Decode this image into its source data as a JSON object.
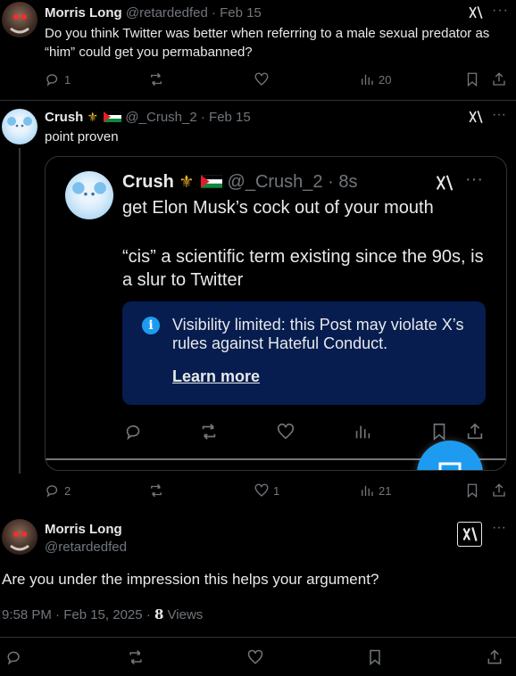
{
  "tweet1": {
    "name": "Morris Long",
    "handle": "@retardedfed",
    "date": "· Feb 15",
    "text": "Do you think Twitter was better when referring to a male sexual predator as “him” could get you permabanned?",
    "replies": "1",
    "views": "20"
  },
  "tweet2": {
    "name": "Crush",
    "handle": "@_Crush_2",
    "date": "· Feb 15",
    "text": "point proven",
    "replies": "2",
    "likes": "1",
    "views": "21"
  },
  "quote": {
    "name": "Crush",
    "handle": "@_Crush_2",
    "time": "· 8s",
    "line1": "get Elon Musk’s cock out of your mouth",
    "line2": "“cis” a scientific term existing since the 90s, is a slur to Twitter",
    "notice": "Visibility limited: this Post may violate X’s rules against Hateful Conduct.",
    "learn_more": "Learn more"
  },
  "main": {
    "name": "Morris Long",
    "handle": "@retardedfed",
    "text": "Are you under the impression this helps your argument?",
    "timestamp": "9:58 PM · Feb 15, 2025 · ",
    "views_count": "8",
    "views_label": " Views"
  },
  "colors": {
    "accent": "#1d9bf0",
    "notice_bg": "#071d4f",
    "muted": "#71767b"
  }
}
